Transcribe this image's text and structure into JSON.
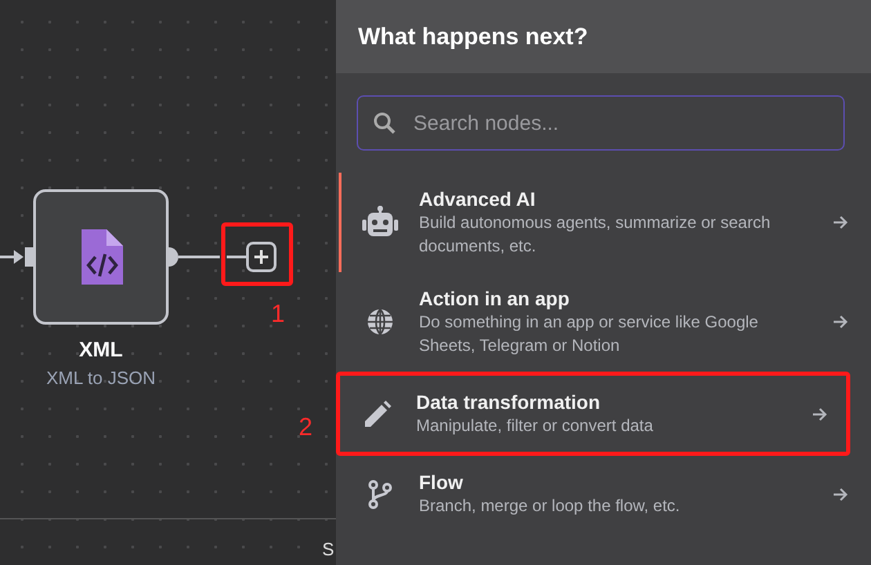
{
  "canvas": {
    "node": {
      "title": "XML",
      "subtitle": "XML to JSON"
    },
    "annotations": [
      {
        "label": "1"
      },
      {
        "label": "2"
      }
    ],
    "bottom_bar": {
      "text": "S"
    }
  },
  "panel": {
    "title": "What happens next?",
    "search": {
      "placeholder": "Search nodes..."
    },
    "items": [
      {
        "kind": "ai",
        "title": "Advanced AI",
        "description": "Build autonomous agents, summarize or search documents, etc.",
        "selected": true,
        "highlighted": false
      },
      {
        "kind": "app",
        "title": "Action in an app",
        "description": "Do something in an app or service like Google Sheets, Telegram or Notion",
        "selected": false,
        "highlighted": false
      },
      {
        "kind": "transform",
        "title": "Data transformation",
        "description": "Manipulate, filter or convert data",
        "selected": false,
        "highlighted": true
      },
      {
        "kind": "flow",
        "title": "Flow",
        "description": "Branch, merge or loop the flow, etc.",
        "selected": false,
        "highlighted": false
      }
    ]
  }
}
